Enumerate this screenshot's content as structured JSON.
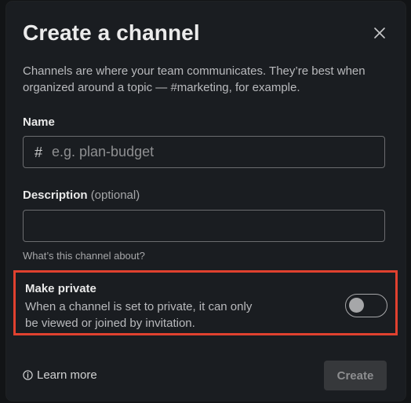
{
  "modal": {
    "title": "Create a channel",
    "close_icon": "close-icon",
    "intro": "Channels are where your team communicates. They’re best when organized around a topic — #marketing, for example."
  },
  "name_field": {
    "label": "Name",
    "prefix": "#",
    "placeholder": "e.g. plan-budget",
    "value": ""
  },
  "description_field": {
    "label": "Description",
    "optional": "(optional)",
    "value": "",
    "hint": "What’s this channel about?"
  },
  "private_setting": {
    "title": "Make private",
    "description": "When a channel is set to private, it can only be viewed or joined by invitation.",
    "enabled": false,
    "highlight_color": "#e0412f"
  },
  "footer": {
    "learn_more": "Learn more",
    "learn_more_icon": "info-icon",
    "create_label": "Create",
    "create_enabled": false
  }
}
